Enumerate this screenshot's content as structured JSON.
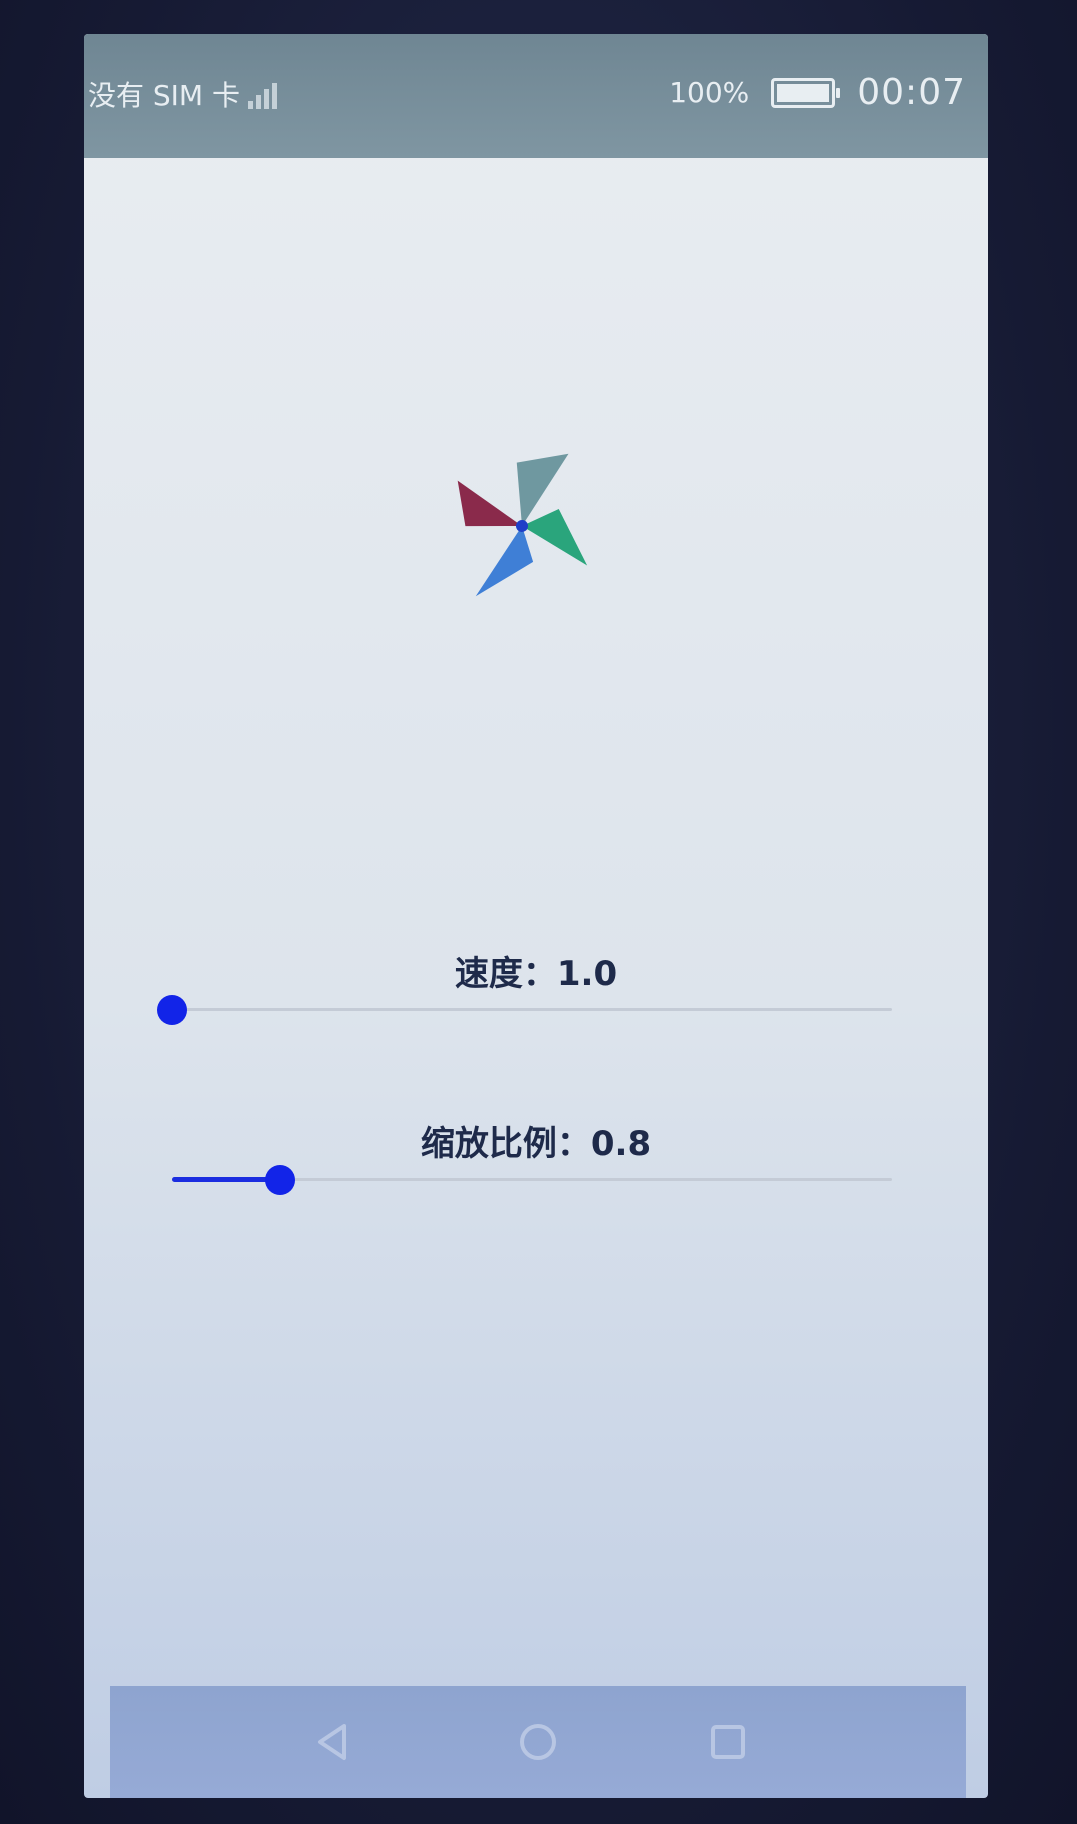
{
  "statusbar": {
    "carrier": "没有 SIM 卡",
    "battery_percent": "100%",
    "time": "00:07"
  },
  "main": {
    "speed_label": "速度：1.0",
    "speed_value": 1.0,
    "speed_fraction": 0.0,
    "scale_label": "缩放比例：0.8",
    "scale_value": 0.8,
    "scale_fraction": 0.15
  },
  "windmill": {
    "blade_colors": [
      "#8a2a4b",
      "#6f98a0",
      "#2aa57c",
      "#3f7fd6"
    ],
    "hub_color": "#1f3fc8"
  },
  "navbar": {
    "icons": [
      "back-icon",
      "home-icon",
      "recent-apps-icon"
    ]
  },
  "colors": {
    "accent": "#1224e8",
    "track": "#c4cbd6"
  }
}
